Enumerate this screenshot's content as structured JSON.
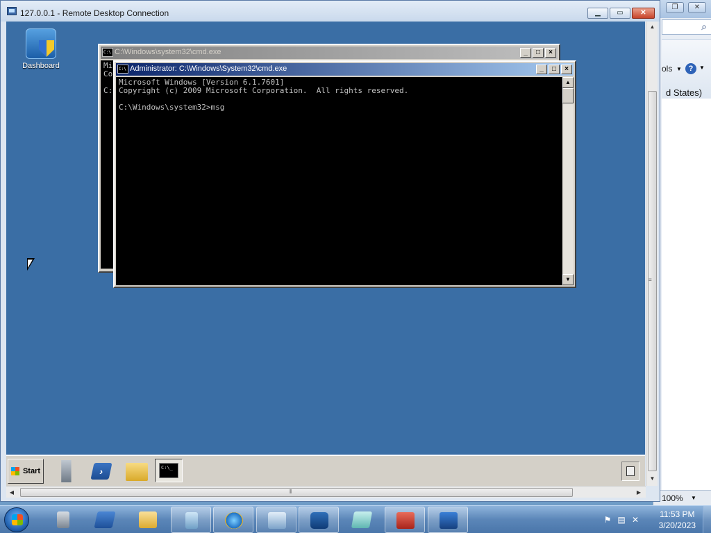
{
  "ie": {
    "tools_label": "ols",
    "help_label": "?",
    "region_text": "d States)",
    "zoom": "100%"
  },
  "rdc": {
    "title": "127.0.0.1 - Remote Desktop Connection"
  },
  "remote_desktop": {
    "dashboard_label": "Dashboard",
    "start_label": "Start",
    "cmd_thumb_text": "C:\\_"
  },
  "cmd_back": {
    "title": "C:\\Windows\\system32\\cmd.exe",
    "visible_text": "Mi\nCo\n\nC:"
  },
  "cmd_front": {
    "title": "Administrator: C:\\Windows\\System32\\cmd.exe",
    "lines": "Microsoft Windows [Version 6.1.7601]\nCopyright (c) 2009 Microsoft Corporation.  All rights reserved.\n\nC:\\Windows\\system32>msg"
  },
  "taskbar": {
    "time": "11:53 PM",
    "date": "3/20/2023",
    "pinned": [
      "server-manager",
      "powershell",
      "explorer",
      "program-manager",
      "internet-explorer",
      "control-panel",
      "network",
      "notepad",
      "toolbox",
      "remote-desktop"
    ]
  },
  "colors": {
    "remote_desktop_bg": "#3a6ea5",
    "console_bg": "#000000",
    "console_fg": "#c0c0c0"
  }
}
